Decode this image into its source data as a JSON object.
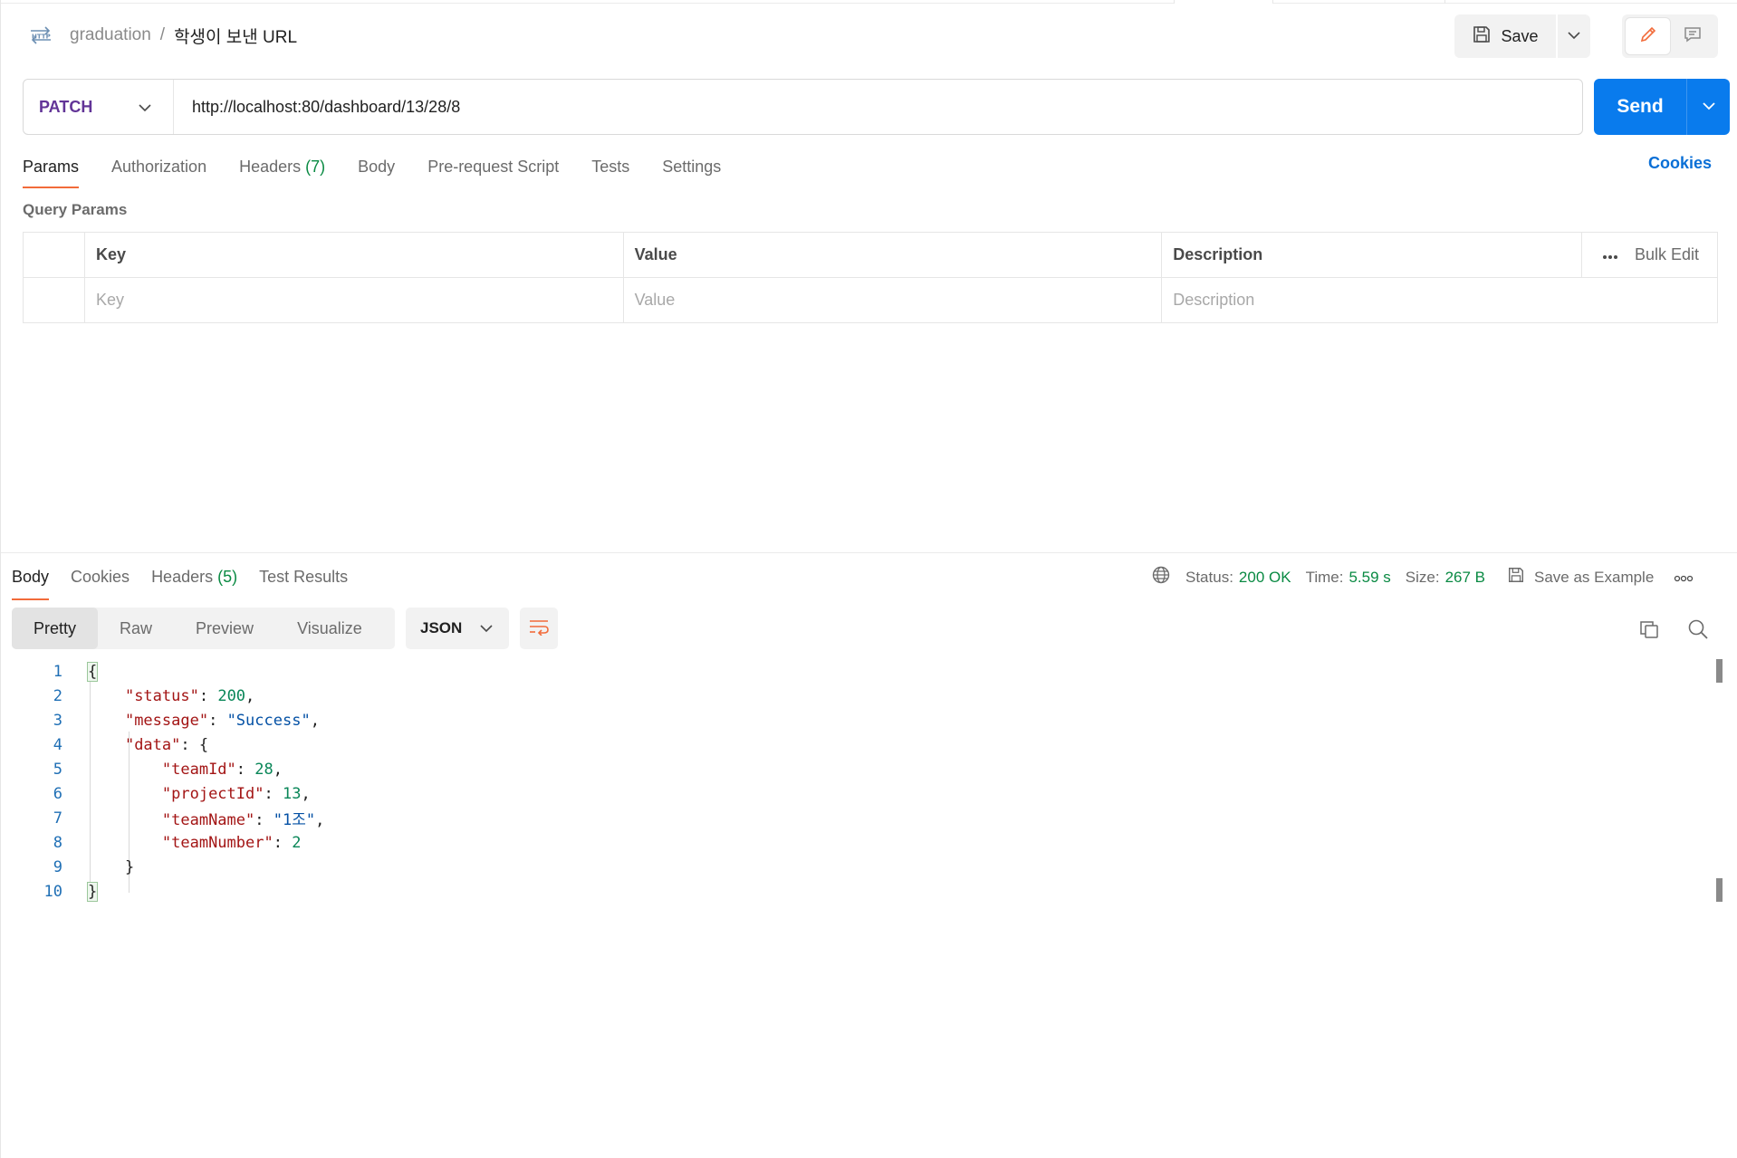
{
  "header": {
    "breadcrumb_parent": "graduation",
    "breadcrumb_sep": "/",
    "breadcrumb_current": "학생이 보낸 URL",
    "save_label": "Save"
  },
  "request": {
    "method": "PATCH",
    "url": "http://localhost:80/dashboard/13/28/8",
    "send_label": "Send"
  },
  "request_tabs": [
    {
      "label": "Params",
      "active": true
    },
    {
      "label": "Authorization"
    },
    {
      "label": "Headers",
      "count": "(7)"
    },
    {
      "label": "Body"
    },
    {
      "label": "Pre-request Script"
    },
    {
      "label": "Tests"
    },
    {
      "label": "Settings"
    }
  ],
  "cookies_label": "Cookies",
  "query_params": {
    "section_label": "Query Params",
    "headers": {
      "key": "Key",
      "value": "Value",
      "description": "Description",
      "bulk_edit": "Bulk Edit"
    },
    "placeholders": {
      "key": "Key",
      "value": "Value",
      "description": "Description"
    }
  },
  "response_tabs": [
    {
      "label": "Body",
      "active": true
    },
    {
      "label": "Cookies"
    },
    {
      "label": "Headers",
      "count": "(5)"
    },
    {
      "label": "Test Results"
    }
  ],
  "response_meta": {
    "status_label": "Status:",
    "status_value": "200 OK",
    "time_label": "Time:",
    "time_value": "5.59 s",
    "size_label": "Size:",
    "size_value": "267 B",
    "save_example": "Save as Example"
  },
  "format_tabs": [
    "Pretty",
    "Raw",
    "Preview",
    "Visualize"
  ],
  "format_active": "Pretty",
  "language": "JSON",
  "code_lines": [
    {
      "n": "1"
    },
    {
      "n": "2"
    },
    {
      "n": "3"
    },
    {
      "n": "4"
    },
    {
      "n": "5"
    },
    {
      "n": "6"
    },
    {
      "n": "7"
    },
    {
      "n": "8"
    },
    {
      "n": "9"
    },
    {
      "n": "10"
    }
  ],
  "json_body": {
    "status_key": "\"status\"",
    "status_val": "200",
    "message_key": "\"message\"",
    "message_val": "\"Success\"",
    "data_key": "\"data\"",
    "teamId_key": "\"teamId\"",
    "teamId_val": "28",
    "projectId_key": "\"projectId\"",
    "projectId_val": "13",
    "teamName_key": "\"teamName\"",
    "teamName_val": "\"1조\"",
    "teamNumber_key": "\"teamNumber\"",
    "teamNumber_val": "2"
  },
  "colors": {
    "accent_orange": "#f26b3a",
    "send_blue": "#097bed",
    "method_purple": "#623497",
    "success_green": "#0a8a43"
  }
}
